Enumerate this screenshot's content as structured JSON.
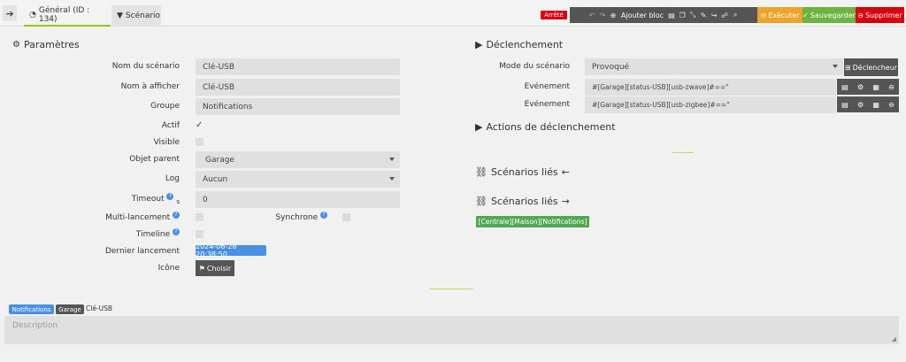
{
  "header": {
    "tab_general": "Général (ID : 134)",
    "tab_scenario": "Scénario",
    "status": "Arrêté",
    "add_block": "Ajouter bloc",
    "execute": "Exécuter",
    "save": "Sauvegarder",
    "delete": "Supprimer"
  },
  "params": {
    "title": "Paramètres",
    "name_label": "Nom du scénario",
    "name_value": "Clé-USB",
    "display_label": "Nom à afficher",
    "display_value": "Clé-USB",
    "group_label": "Groupe",
    "group_value": "Notifications",
    "active_label": "Actif",
    "visible_label": "Visible",
    "parent_label": "Objet parent",
    "parent_value": "Garage",
    "log_label": "Log",
    "log_value": "Aucun",
    "timeout_label": "Timeout",
    "timeout_unit": "s",
    "timeout_value": "0",
    "multi_label": "Multi-lancement",
    "sync_label": "Synchrone",
    "timeline_label": "Timeline",
    "last_run_label": "Dernier lancement",
    "last_run_value": "2024-06-28 20:38:50",
    "icon_label": "Icône",
    "choose": "Choisir"
  },
  "trigger": {
    "title": "Déclenchement",
    "mode_label": "Mode du scénario",
    "mode_value": "Provoqué",
    "trigger_btn": "Déclencheur",
    "event_label": "Evénement",
    "event1": "#[Garage][status-USB][usb-zwave]#==\"",
    "event2": "#[Garage][status-USB][usb-zigbee]#==\"",
    "actions_title": "Actions de déclenchement",
    "linked_prev": "Scénarios liés",
    "linked_next": "Scénarios liés",
    "linked_tag": "[Centrale][Maison][Notifications]"
  },
  "footer": {
    "tag_notifications": "Notifications",
    "tag_garage": "Garage",
    "name": "Clé-USB",
    "description_placeholder": "Description"
  }
}
